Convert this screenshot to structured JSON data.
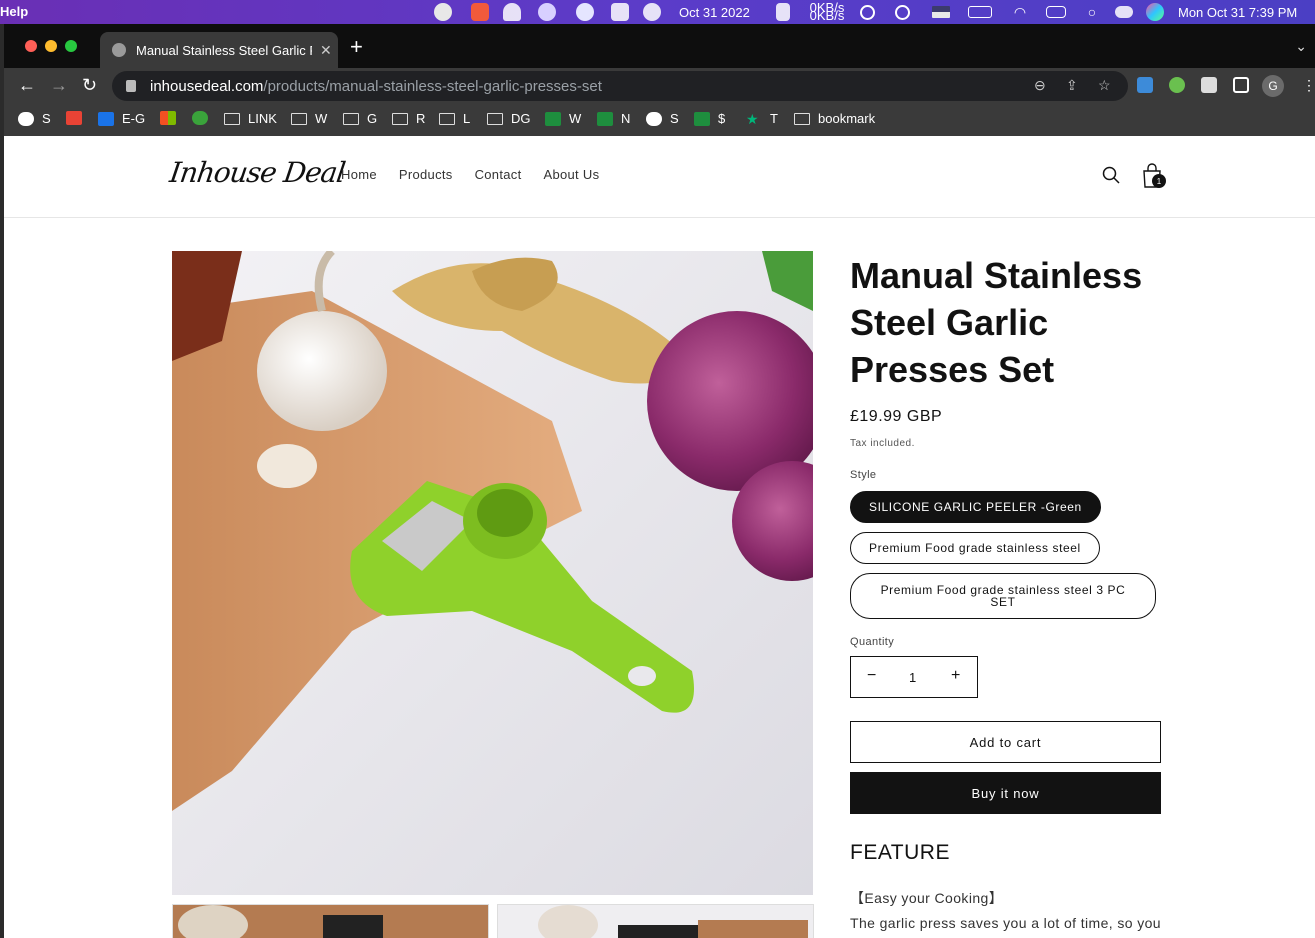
{
  "menubar": {
    "app_menu": "Help",
    "date_short": "Oct 31 2022",
    "net_up": "0KB/s",
    "net_down": "0KB/s",
    "datetime": "Mon Oct 31  7:39 PM"
  },
  "browser": {
    "tab_title": "Manual Stainless Steel Garlic P",
    "tab_close": "✕",
    "new_tab": "+",
    "url_host": "inhousedeal.com",
    "url_path": "/products/manual-stainless-steel-garlic-presses-set",
    "profile_initial": "G",
    "bookmarks": [
      "S",
      "",
      "E-G",
      "",
      "",
      "LINK",
      "W",
      "G",
      "R",
      "L",
      "DG",
      "W",
      "N",
      "S",
      "$",
      "T",
      "bookmark"
    ]
  },
  "site": {
    "logo": "Inhouse Deal",
    "nav": [
      "Home",
      "Products",
      "Contact",
      "About Us"
    ],
    "cart_count": "1"
  },
  "product": {
    "title": "Manual Stainless Steel Garlic Presses Set",
    "price": "£19.99 GBP",
    "tax_note": "Tax included.",
    "style_label": "Style",
    "styles": [
      "SILICONE GARLIC PEELER -Green",
      "Premium Food grade stainless steel",
      "Premium Food grade stainless steel 3 PC SET"
    ],
    "selected_style": "SILICONE GARLIC PEELER -Green",
    "quantity_label": "Quantity",
    "quantity": "1",
    "minus": "−",
    "plus": "+",
    "add_to_cart": "Add to cart",
    "buy_now": "Buy it now",
    "feature_heading": "FEATURE",
    "feature_sub": "【Easy your Cooking】",
    "feature_text": "The garlic press saves you a lot of time, so you"
  },
  "colors": {
    "menubar": "#5b3cc9",
    "accent_dark": "#121212",
    "product_green": "#8fd12b"
  }
}
